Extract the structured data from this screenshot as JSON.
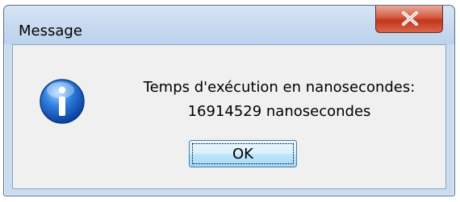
{
  "dialog": {
    "title": "Message",
    "close_icon": "close-icon",
    "icon": "info-icon",
    "message_line1": "Temps d'exécution en nanosecondes:",
    "message_line2": "16914529 nanosecondes",
    "ok_label": "OK"
  }
}
